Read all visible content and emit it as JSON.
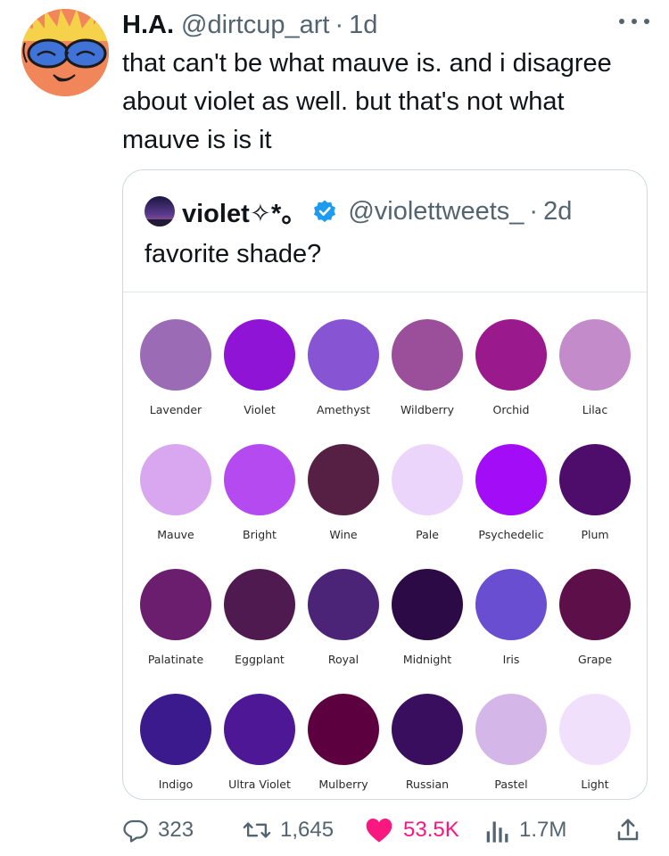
{
  "tweet": {
    "author_name": "H.A.",
    "handle": "@dirtcup_art",
    "separator": "·",
    "age": "1d",
    "text": "that can't be what mauve is. and i disagree about violet as well. but that's not what mauve is is it",
    "avatar_icon": "cartoon-avatar-icon",
    "more_icon": "more-options-icon"
  },
  "quote": {
    "author_name": "violet✧*。",
    "verified_icon": "verified-badge-icon",
    "handle": "@violettweets_",
    "separator": "·",
    "age": "2d",
    "text": "favorite shade?",
    "swatches": [
      {
        "label": "Lavender",
        "color": "#9b6bb5"
      },
      {
        "label": "Violet",
        "color": "#8f14d6"
      },
      {
        "label": "Amethyst",
        "color": "#8755d4"
      },
      {
        "label": "Wildberry",
        "color": "#9b4e99"
      },
      {
        "label": "Orchid",
        "color": "#9a1a8e"
      },
      {
        "label": "Lilac",
        "color": "#c48bca"
      },
      {
        "label": "Mauve",
        "color": "#d9a6f0"
      },
      {
        "label": "Bright",
        "color": "#b54af0"
      },
      {
        "label": "Wine",
        "color": "#552043"
      },
      {
        "label": "Pale",
        "color": "#ecd5fb"
      },
      {
        "label": "Psychedelic",
        "color": "#a30cf7"
      },
      {
        "label": "Plum",
        "color": "#4e0d6b"
      },
      {
        "label": "Palatinate",
        "color": "#6b1d6e"
      },
      {
        "label": "Eggplant",
        "color": "#4e1a4f"
      },
      {
        "label": "Royal",
        "color": "#4b2478"
      },
      {
        "label": "Midnight",
        "color": "#2c0a45"
      },
      {
        "label": "Iris",
        "color": "#6a4ed2"
      },
      {
        "label": "Grape",
        "color": "#5c0f49"
      },
      {
        "label": "Indigo",
        "color": "#3a1a8c"
      },
      {
        "label": "Ultra Violet",
        "color": "#4d1795"
      },
      {
        "label": "Mulberry",
        "color": "#5c0040"
      },
      {
        "label": "Russian",
        "color": "#3a0e5e"
      },
      {
        "label": "Pastel",
        "color": "#d4b6e8"
      },
      {
        "label": "Light",
        "color": "#f1e0fb"
      }
    ]
  },
  "actions": {
    "replies": "323",
    "reposts": "1,645",
    "likes": "53.5K",
    "views": "1.7M",
    "reply_icon": "reply-icon",
    "repost_icon": "repost-icon",
    "like_icon": "heart-icon",
    "views_icon": "views-icon",
    "share_icon": "share-icon",
    "like_color": "#f91880"
  }
}
